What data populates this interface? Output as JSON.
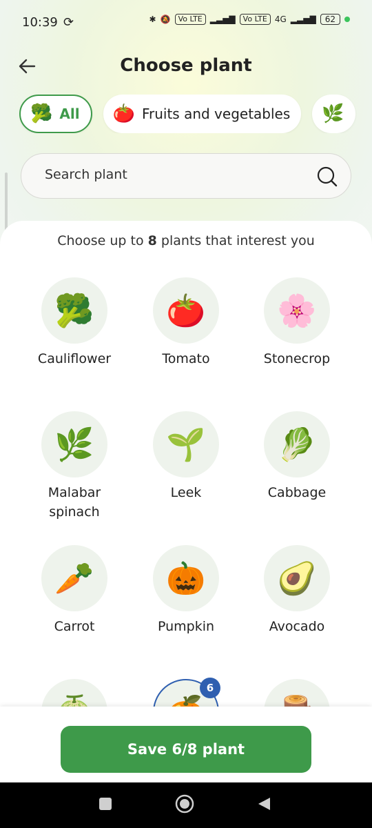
{
  "status": {
    "time": "10:39",
    "battery": "62",
    "network": "4G",
    "volte1": "Vo LTE",
    "volte2": "Vo LTE"
  },
  "header": {
    "title": "Choose plant"
  },
  "chips": [
    {
      "label": "All",
      "icon": "mixed-produce-icon",
      "emoji": "🥦"
    },
    {
      "label": "Fruits and vegetables",
      "icon": "fruits-vegetables-icon",
      "emoji": "🍅"
    },
    {
      "label": "",
      "icon": "herbs-icon",
      "emoji": "🌿"
    }
  ],
  "search": {
    "placeholder": "Search plant"
  },
  "instruction": {
    "prefix": "Choose up to ",
    "count": "8",
    "suffix": " plants that interest you"
  },
  "plants": [
    {
      "name": "Cauliflower",
      "emoji": "🥦",
      "selected": false
    },
    {
      "name": "Tomato",
      "emoji": "🍅",
      "selected": false
    },
    {
      "name": "Stonecrop",
      "emoji": "🌸",
      "selected": false
    },
    {
      "name": "Malabar spinach",
      "emoji": "🌿",
      "selected": false
    },
    {
      "name": "Leek",
      "emoji": "🌱",
      "selected": false
    },
    {
      "name": "Cabbage",
      "emoji": "🥬",
      "selected": false
    },
    {
      "name": "Carrot",
      "emoji": "🥕",
      "selected": false
    },
    {
      "name": "Pumpkin",
      "emoji": "🎃",
      "selected": false
    },
    {
      "name": "Avocado",
      "emoji": "🥑",
      "selected": false
    },
    {
      "name": "",
      "emoji": "🍈",
      "selected": false
    },
    {
      "name": "",
      "emoji": "🍊",
      "selected": true,
      "badge": "6"
    },
    {
      "name": "",
      "emoji": "🪵",
      "selected": false
    }
  ],
  "footer": {
    "save_label": "Save 6/8 plant"
  },
  "colors": {
    "accent": "#3e9a4a",
    "selected": "#2f5fb0"
  }
}
